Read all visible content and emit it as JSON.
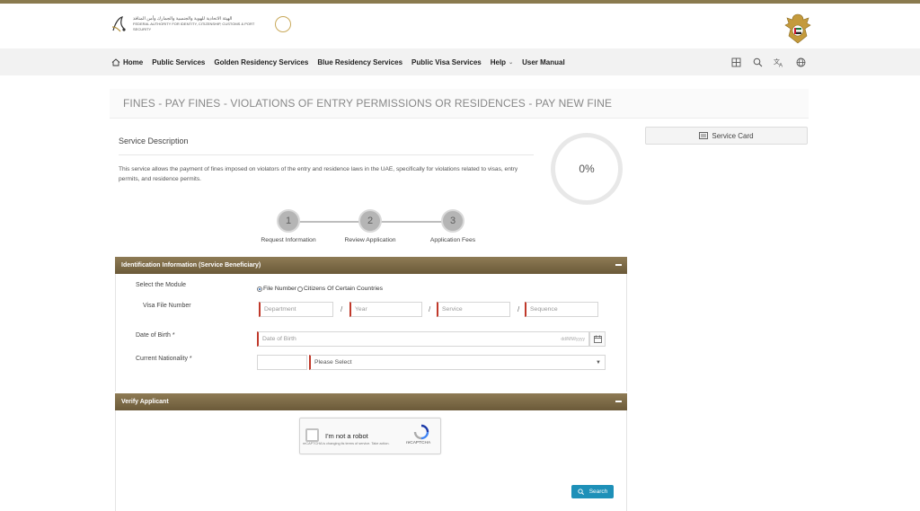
{
  "header": {
    "logo_text_ar": "الهيئة الاتحادية للهوية والجنسية والجمارك وأمن المنافذ",
    "logo_text_en": "FEDERAL AUTHORITY FOR IDENTITY, CITIZENSHIP, CUSTOMS & PORT SECURITY",
    "emblem": "uae-emblem"
  },
  "nav": {
    "items": [
      {
        "label": "Home",
        "icon": "home-icon"
      },
      {
        "label": "Public Services"
      },
      {
        "label": "Golden Residency Services"
      },
      {
        "label": "Blue Residency Services"
      },
      {
        "label": "Public Visa Services"
      },
      {
        "label": "Help",
        "has_caret": true
      },
      {
        "label": "User Manual"
      }
    ],
    "tools": [
      "sitemap-icon",
      "search-icon",
      "translate-icon",
      "globe-icon"
    ]
  },
  "page": {
    "title": "FINES - PAY FINES - VIOLATIONS OF ENTRY PERMISSIONS OR RESIDENCES - PAY NEW FINE"
  },
  "service": {
    "description_title": "Service Description",
    "description_text": "This service allows the payment of fines imposed on violators of the entry and residence laws in the UAE, specifically for violations related to visas, entry permits, and residence permits.",
    "progress": "0%",
    "card_button": "Service Card"
  },
  "steps": [
    {
      "number": "1",
      "label": "Request Information"
    },
    {
      "number": "2",
      "label": "Review Application"
    },
    {
      "number": "3",
      "label": "Application Fees"
    }
  ],
  "identification": {
    "header": "Identification Information (Service Beneficiary)",
    "module_label": "Select the Module",
    "module_options": [
      {
        "label": "File Number",
        "selected": true
      },
      {
        "label": "Citizens Of Certain Countries",
        "selected": false
      }
    ],
    "visa_label": "Visa File Number",
    "visa_fields": {
      "department": "Department",
      "year": "Year",
      "service": "Service",
      "sequence": "Sequence"
    },
    "separator": "/",
    "dob_label": "Date of Birth *",
    "dob_placeholder": "Date of Birth",
    "dob_format": "dd/MM/yyyy",
    "nationality_label": "Current Nationality *",
    "nationality_code": "",
    "nationality_placeholder": "Please Select"
  },
  "verify": {
    "header": "Verify Applicant",
    "captcha_label": "I'm not a robot",
    "captcha_brand": "reCAPTCHA",
    "captcha_fine": "reCAPTCHA is changing its terms of service. Take action.",
    "search_button": "Search"
  },
  "colors": {
    "panel_header": "#7d6b47",
    "accent_gold": "#8a7a4e",
    "search_button": "#1e90b8",
    "required_marker": "#c0392b"
  }
}
